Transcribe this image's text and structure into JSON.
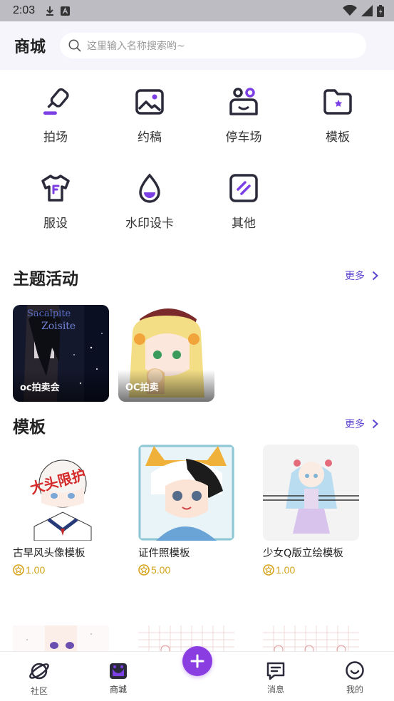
{
  "status_bar": {
    "time": "2:03"
  },
  "header": {
    "title": "商城",
    "search_placeholder": "这里输入名称搜索哟~"
  },
  "categories": [
    {
      "label": "拍场",
      "icon": "gavel-icon"
    },
    {
      "label": "约稿",
      "icon": "image-icon"
    },
    {
      "label": "停车场",
      "icon": "people-icon"
    },
    {
      "label": "模板",
      "icon": "template-folder-icon"
    },
    {
      "label": "服设",
      "icon": "tshirt-icon"
    },
    {
      "label": "水印设卡",
      "icon": "water-drop-icon"
    },
    {
      "label": "其他",
      "icon": "other-icon"
    }
  ],
  "activity_section": {
    "title": "主题活动",
    "more": "更多",
    "cards": [
      {
        "label": "oc拍卖会"
      },
      {
        "label": "OC拍卖"
      }
    ]
  },
  "template_section": {
    "title": "模板",
    "more": "更多",
    "items": [
      {
        "name": "古早风头像模板",
        "price": "1.00"
      },
      {
        "name": "证件照模板",
        "price": "5.00"
      },
      {
        "name": "少女Q版立绘模板",
        "price": "1.00"
      }
    ]
  },
  "bottom_nav": {
    "items": [
      {
        "label": "社区",
        "icon": "planet-icon"
      },
      {
        "label": "商城",
        "icon": "shop-icon"
      },
      {
        "label": "消息",
        "icon": "message-icon"
      },
      {
        "label": "我的",
        "icon": "smile-icon"
      }
    ]
  },
  "colors": {
    "accent": "#7b3fe4",
    "price": "#d6a31a",
    "more": "#5d43d0"
  }
}
